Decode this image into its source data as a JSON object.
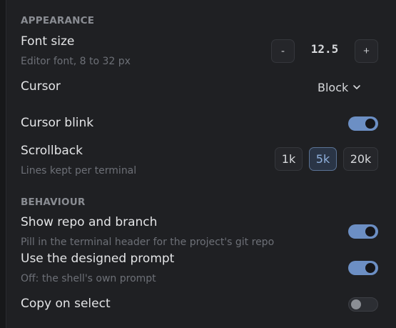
{
  "appearance": {
    "heading": "APPEARANCE",
    "font_size": {
      "label": "Font size",
      "description": "Editor font, 8 to 32 px",
      "decrement_label": "-",
      "value": "12.5",
      "increment_label": "+"
    },
    "cursor": {
      "label": "Cursor",
      "selected": "Block"
    },
    "cursor_blink": {
      "label": "Cursor blink",
      "enabled": true
    },
    "scrollback": {
      "label": "Scrollback",
      "description": "Lines kept per terminal",
      "options": [
        "1k",
        "5k",
        "20k"
      ],
      "selected": "5k"
    }
  },
  "behaviour": {
    "heading": "BEHAVIOUR",
    "show_repo": {
      "label": "Show repo and branch",
      "description": "Pill in the terminal header for the project's git repo",
      "enabled": true
    },
    "designed_prompt": {
      "label": "Use the designed prompt",
      "description": "Off: the shell's own prompt",
      "enabled": true
    },
    "copy_on_select": {
      "label": "Copy on select",
      "enabled": false
    }
  },
  "colors": {
    "accent": "#6c8fc4",
    "panel_bg": "#1f2023",
    "text_primary": "#e3e4e6",
    "text_muted": "#6d7077"
  }
}
